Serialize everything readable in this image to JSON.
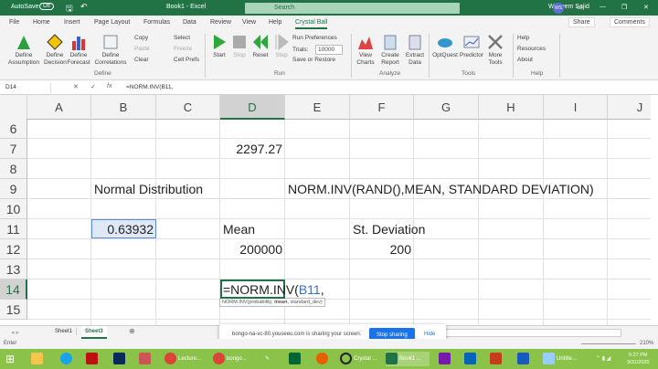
{
  "titlebar": {
    "autosave": "AutoSave",
    "autosave_state": "Off",
    "doc_title": "Book1 - Excel",
    "search_placeholder": "Search",
    "user": "Waseem Sajid",
    "initials": "WS"
  },
  "tabs": [
    "File",
    "Home",
    "Insert",
    "Page Layout",
    "Formulas",
    "Data",
    "Review",
    "View",
    "Help",
    "Crystal Ball"
  ],
  "share": "Share",
  "comments": "Comments",
  "ribbon": {
    "define": {
      "assumption": "Define Assumption",
      "decision": "Define Decision",
      "forecast": "Define Forecast",
      "correlations": "Define Correlations",
      "copy": "Copy",
      "paste": "Paste",
      "clear": "Clear",
      "select": "Select",
      "freeze": "Freeze",
      "cell_prefs": "Cell Prefs",
      "label": "Define"
    },
    "run": {
      "start": "Start",
      "stop": "Stop",
      "reset": "Reset",
      "step": "Step",
      "run_prefs": "Run Preferences",
      "trials_label": "Trials:",
      "trials": "10000",
      "save_restore": "Save or Restore",
      "label": "Run"
    },
    "analyze": {
      "view_charts": "View Charts",
      "create_report": "Create Report",
      "extract_data": "Extract Data",
      "label": "Analyze"
    },
    "tools": {
      "optquest": "OptQuest",
      "predictor": "Predictor",
      "more_tools": "More Tools",
      "label": "Tools"
    },
    "help": {
      "help": "Help",
      "resources": "Resources",
      "about": "About",
      "label": "Help"
    }
  },
  "formula_bar": {
    "name_box": "D14",
    "formula": "=NORM.INV(B11,"
  },
  "columns": [
    "A",
    "B",
    "C",
    "D",
    "E",
    "F",
    "G",
    "H",
    "I",
    "J"
  ],
  "rows": [
    "6",
    "7",
    "8",
    "9",
    "10",
    "11",
    "12",
    "13",
    "14",
    "15"
  ],
  "cells": {
    "D7": "2297.27",
    "B9": "Normal Distribution",
    "E9": "NORM.INV(RAND(),MEAN, STANDARD DEVIATION)",
    "B11": "0.63932",
    "D11": "Mean",
    "F11": "St. Deviation",
    "D12": "200000",
    "F12": "200",
    "D14_prefix": "=NORM.INV(",
    "D14_ref": "B11",
    "D14_suffix": ","
  },
  "tooltip": {
    "fn": "NORM.INV(probability, ",
    "bold": "mean",
    "rest": ", standard_dev)"
  },
  "sheets": [
    "Sheet1",
    "Sheet3"
  ],
  "active_sheet": "Sheet3",
  "share_banner": {
    "text": "bongo-na-vc-80.youseeu.com is sharing your screen.",
    "stop": "Stop sharing",
    "hide": "Hide"
  },
  "status": {
    "mode": "Enter",
    "zoom": "210%"
  },
  "taskbar": {
    "items": [
      "Lecture...",
      "bongo...",
      "Crystal ...",
      "Book1 ...",
      "Untitle..."
    ],
    "time": "5:27 PM",
    "date": "3/31/2020"
  },
  "colors": {
    "excel_green": "#217346",
    "accent_blue": "#1a73e8",
    "taskbar": "#8bc34a"
  }
}
